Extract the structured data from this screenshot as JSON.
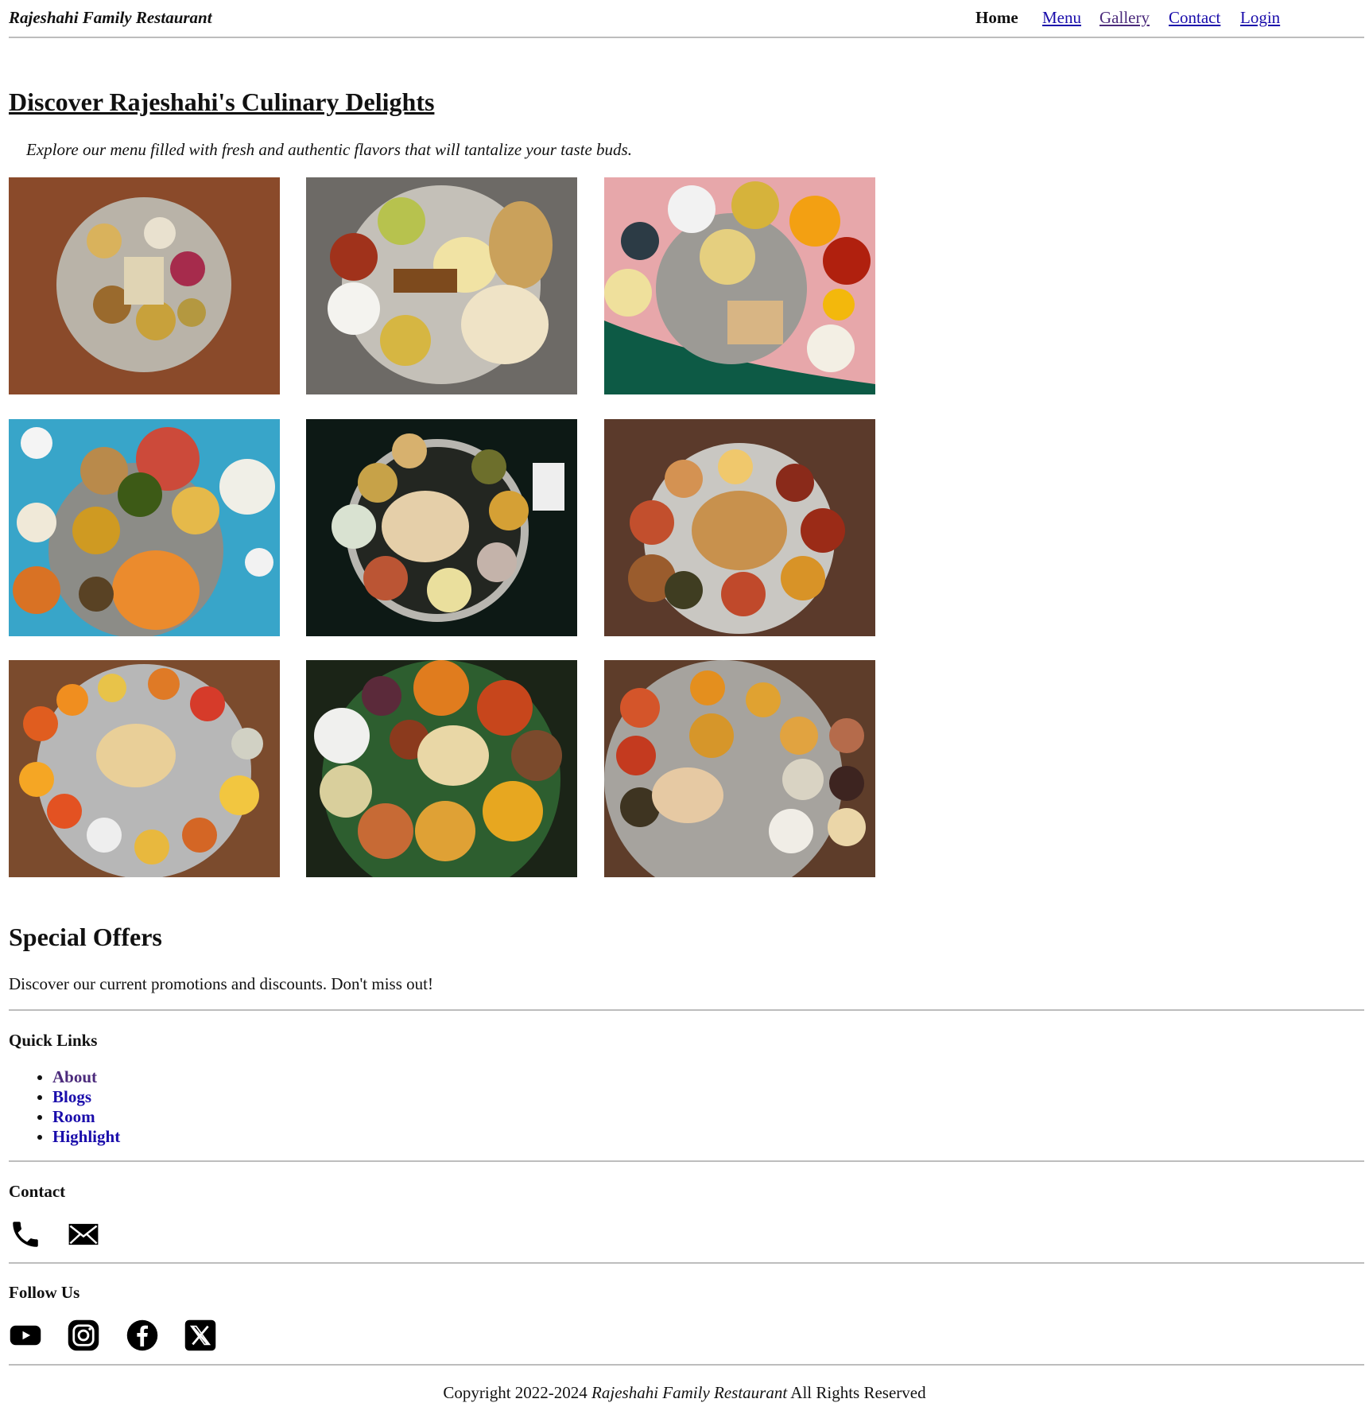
{
  "header": {
    "brand": "Rajeshahi Family Restaurant",
    "nav": {
      "home": "Home",
      "menu": "Menu",
      "gallery": "Gallery",
      "contact": "Contact",
      "login": "Login"
    }
  },
  "hero": {
    "title": "Discover Rajeshahi's Culinary Delights",
    "subtitle": "Explore our menu filled with fresh and authentic flavors that will tantalize your taste buds."
  },
  "gallery": {
    "images": [
      {
        "bg": "#8a4a2a",
        "plate": "#b9b3a8"
      },
      {
        "bg": "#6d6a66",
        "plate": "#c4c0b8"
      },
      {
        "bg": "#e7a7aa",
        "plate": "#9c9a95"
      },
      {
        "bg": "#38a5c9",
        "plate": "#8c8c87"
      },
      {
        "bg": "#0d1915",
        "plate": "#b8b6b0"
      },
      {
        "bg": "#5b3a2b",
        "plate": "#c9c7c2"
      },
      {
        "bg": "#7b4b2d",
        "plate": "#b7b7b7"
      },
      {
        "bg": "#1b2417",
        "plate": "#2d5e2f"
      },
      {
        "bg": "#5e3d2a",
        "plate": "#a6a39e"
      }
    ]
  },
  "offers": {
    "title": "Special Offers",
    "text": "Discover our current promotions and discounts. Don't miss out!"
  },
  "quick_links": {
    "title": "Quick Links",
    "items": [
      "About",
      "Blogs",
      "Room",
      "Highlight"
    ]
  },
  "contact": {
    "title": "Contact",
    "icons": [
      "phone-icon",
      "mail-icon"
    ]
  },
  "follow": {
    "title": "Follow Us",
    "icons": [
      "youtube-icon",
      "instagram-icon",
      "facebook-icon",
      "x-icon"
    ]
  },
  "footer": {
    "prefix": "Copyright 2022-2024",
    "brand": "Rajeshahi Family Restaurant",
    "suffix": "All Rights Reserved"
  }
}
